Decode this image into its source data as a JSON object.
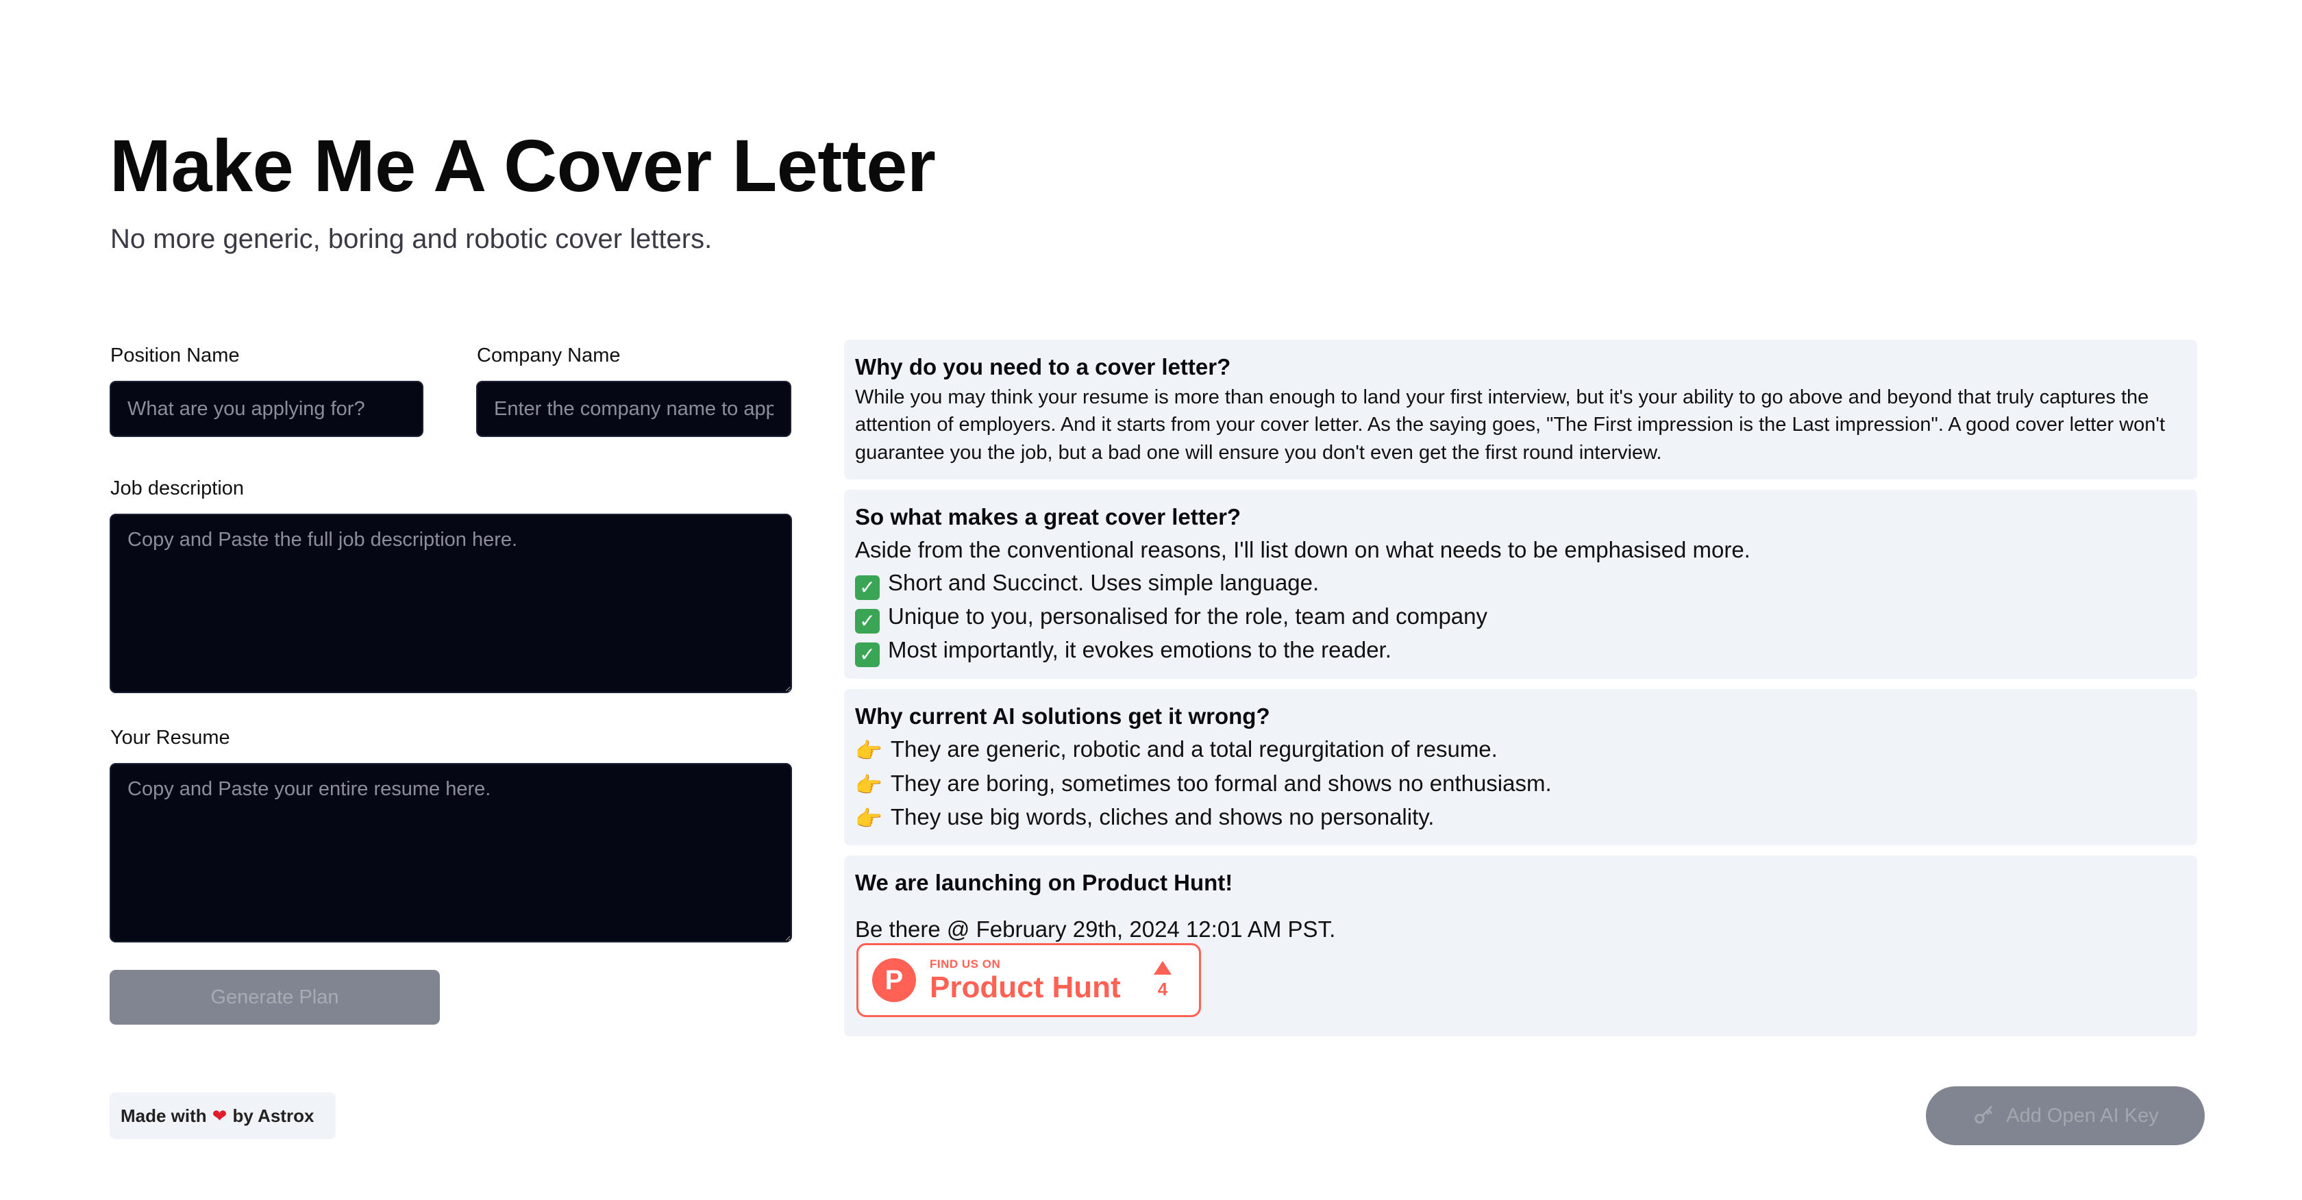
{
  "header": {
    "title": "Make Me A Cover Letter",
    "subtitle": "No more generic, boring and robotic cover letters."
  },
  "form": {
    "position_label": "Position Name",
    "position_placeholder": "What are you applying for?",
    "company_label": "Company Name",
    "company_placeholder": "Enter the company name to apply",
    "job_label": "Job description",
    "job_placeholder": "Copy and Paste the full job description here.",
    "resume_label": "Your Resume",
    "resume_placeholder": "Copy and Paste your entire resume here.",
    "generate_label": "Generate Plan"
  },
  "cards": {
    "why": {
      "title": "Why do you need to a cover letter?",
      "body": "While you may think your resume is more than enough to land your first interview, but it's your ability to go above and beyond that truly captures the attention of employers. And it starts from your cover letter. As the saying goes, \"The First impression is the Last impression\". A good cover letter won't guarantee you the job, but a bad one will ensure you don't even get the first round interview."
    },
    "great": {
      "title": "So what makes a great cover letter?",
      "intro": "Aside from the conventional reasons, I'll list down on what needs to be emphasised more.",
      "items": [
        "Short and Succinct. Uses simple language.",
        "Unique to you, personalised for the role, team and company",
        "Most importantly, it evokes emotions to the reader."
      ]
    },
    "wrong": {
      "title": "Why current AI solutions get it wrong?",
      "items": [
        "They are generic, robotic and a total regurgitation of resume.",
        "They are boring, sometimes too formal and shows no enthusiasm.",
        "They use big words, cliches and shows no personality."
      ]
    },
    "launch": {
      "title": "We are launching on Product Hunt!",
      "text": "Be there @ February 29th, 2024 12:01 AM PST.",
      "badge_find": "FIND US ON",
      "badge_name": "Product Hunt",
      "badge_logo": "P",
      "badge_count": "4"
    }
  },
  "footer": {
    "made_prefix": "Made with",
    "made_suffix": "by Astrox",
    "api_label": "Add Open AI Key"
  },
  "icons": {
    "check": "check-box-icon",
    "point": "pointing-hand-icon",
    "heart": "heart-icon",
    "key": "key-icon"
  },
  "colors": {
    "accent_ph": "#ff6154",
    "input_bg": "#050814",
    "card_bg": "#f0f3f8",
    "disabled_btn": "#808591"
  }
}
